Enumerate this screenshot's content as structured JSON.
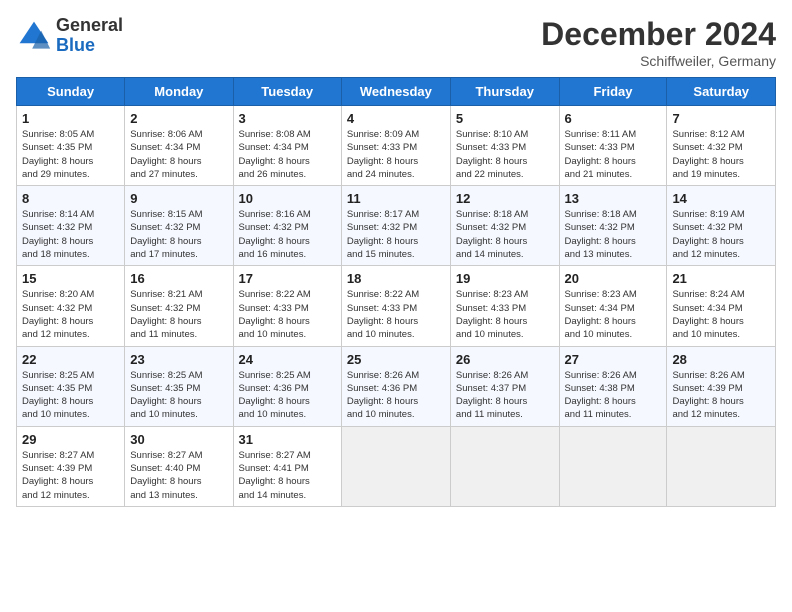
{
  "header": {
    "logo_general": "General",
    "logo_blue": "Blue",
    "month_title": "December 2024",
    "subtitle": "Schiffweiler, Germany"
  },
  "days_of_week": [
    "Sunday",
    "Monday",
    "Tuesday",
    "Wednesday",
    "Thursday",
    "Friday",
    "Saturday"
  ],
  "weeks": [
    [
      {
        "day": 1,
        "sunrise": "8:05 AM",
        "sunset": "4:35 PM",
        "daylight": "8 hours and 29 minutes."
      },
      {
        "day": 2,
        "sunrise": "8:06 AM",
        "sunset": "4:34 PM",
        "daylight": "8 hours and 27 minutes."
      },
      {
        "day": 3,
        "sunrise": "8:08 AM",
        "sunset": "4:34 PM",
        "daylight": "8 hours and 26 minutes."
      },
      {
        "day": 4,
        "sunrise": "8:09 AM",
        "sunset": "4:33 PM",
        "daylight": "8 hours and 24 minutes."
      },
      {
        "day": 5,
        "sunrise": "8:10 AM",
        "sunset": "4:33 PM",
        "daylight": "8 hours and 22 minutes."
      },
      {
        "day": 6,
        "sunrise": "8:11 AM",
        "sunset": "4:33 PM",
        "daylight": "8 hours and 21 minutes."
      },
      {
        "day": 7,
        "sunrise": "8:12 AM",
        "sunset": "4:32 PM",
        "daylight": "8 hours and 19 minutes."
      }
    ],
    [
      {
        "day": 8,
        "sunrise": "8:14 AM",
        "sunset": "4:32 PM",
        "daylight": "8 hours and 18 minutes."
      },
      {
        "day": 9,
        "sunrise": "8:15 AM",
        "sunset": "4:32 PM",
        "daylight": "8 hours and 17 minutes."
      },
      {
        "day": 10,
        "sunrise": "8:16 AM",
        "sunset": "4:32 PM",
        "daylight": "8 hours and 16 minutes."
      },
      {
        "day": 11,
        "sunrise": "8:17 AM",
        "sunset": "4:32 PM",
        "daylight": "8 hours and 15 minutes."
      },
      {
        "day": 12,
        "sunrise": "8:18 AM",
        "sunset": "4:32 PM",
        "daylight": "8 hours and 14 minutes."
      },
      {
        "day": 13,
        "sunrise": "8:18 AM",
        "sunset": "4:32 PM",
        "daylight": "8 hours and 13 minutes."
      },
      {
        "day": 14,
        "sunrise": "8:19 AM",
        "sunset": "4:32 PM",
        "daylight": "8 hours and 12 minutes."
      }
    ],
    [
      {
        "day": 15,
        "sunrise": "8:20 AM",
        "sunset": "4:32 PM",
        "daylight": "8 hours and 12 minutes."
      },
      {
        "day": 16,
        "sunrise": "8:21 AM",
        "sunset": "4:32 PM",
        "daylight": "8 hours and 11 minutes."
      },
      {
        "day": 17,
        "sunrise": "8:22 AM",
        "sunset": "4:33 PM",
        "daylight": "8 hours and 10 minutes."
      },
      {
        "day": 18,
        "sunrise": "8:22 AM",
        "sunset": "4:33 PM",
        "daylight": "8 hours and 10 minutes."
      },
      {
        "day": 19,
        "sunrise": "8:23 AM",
        "sunset": "4:33 PM",
        "daylight": "8 hours and 10 minutes."
      },
      {
        "day": 20,
        "sunrise": "8:23 AM",
        "sunset": "4:34 PM",
        "daylight": "8 hours and 10 minutes."
      },
      {
        "day": 21,
        "sunrise": "8:24 AM",
        "sunset": "4:34 PM",
        "daylight": "8 hours and 10 minutes."
      }
    ],
    [
      {
        "day": 22,
        "sunrise": "8:25 AM",
        "sunset": "4:35 PM",
        "daylight": "8 hours and 10 minutes."
      },
      {
        "day": 23,
        "sunrise": "8:25 AM",
        "sunset": "4:35 PM",
        "daylight": "8 hours and 10 minutes."
      },
      {
        "day": 24,
        "sunrise": "8:25 AM",
        "sunset": "4:36 PM",
        "daylight": "8 hours and 10 minutes."
      },
      {
        "day": 25,
        "sunrise": "8:26 AM",
        "sunset": "4:36 PM",
        "daylight": "8 hours and 10 minutes."
      },
      {
        "day": 26,
        "sunrise": "8:26 AM",
        "sunset": "4:37 PM",
        "daylight": "8 hours and 11 minutes."
      },
      {
        "day": 27,
        "sunrise": "8:26 AM",
        "sunset": "4:38 PM",
        "daylight": "8 hours and 11 minutes."
      },
      {
        "day": 28,
        "sunrise": "8:26 AM",
        "sunset": "4:39 PM",
        "daylight": "8 hours and 12 minutes."
      }
    ],
    [
      {
        "day": 29,
        "sunrise": "8:27 AM",
        "sunset": "4:39 PM",
        "daylight": "8 hours and 12 minutes."
      },
      {
        "day": 30,
        "sunrise": "8:27 AM",
        "sunset": "4:40 PM",
        "daylight": "8 hours and 13 minutes."
      },
      {
        "day": 31,
        "sunrise": "8:27 AM",
        "sunset": "4:41 PM",
        "daylight": "8 hours and 14 minutes."
      },
      null,
      null,
      null,
      null
    ]
  ]
}
